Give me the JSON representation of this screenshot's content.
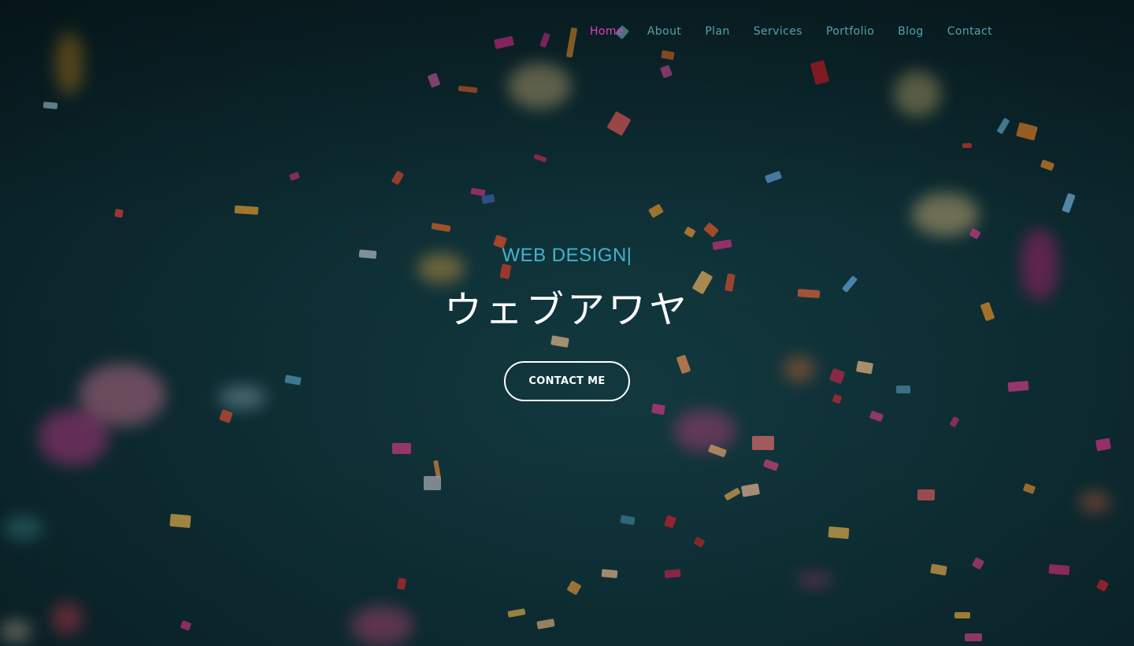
{
  "nav": {
    "items": [
      {
        "label": "Home",
        "active": true
      },
      {
        "label": "About",
        "active": false
      },
      {
        "label": "Plan",
        "active": false
      },
      {
        "label": "Services",
        "active": false
      },
      {
        "label": "Portfolio",
        "active": false
      },
      {
        "label": "Blog",
        "active": false
      },
      {
        "label": "Contact",
        "active": false
      }
    ]
  },
  "hero": {
    "subtitle": "WEB DESIGN|",
    "title": "ウェブアワヤ",
    "cta_label": "CONTACT ME"
  },
  "colors": {
    "nav_text": "#4fa3ae",
    "nav_active": "#e040b7",
    "subtitle": "#43b4cf",
    "title": "#ffffff",
    "background": "#0d2d33"
  }
}
